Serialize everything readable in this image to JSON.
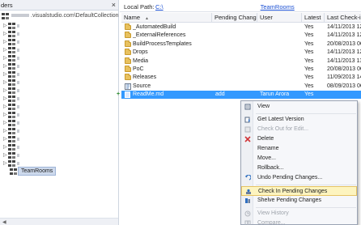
{
  "left_pane": {
    "title": "ders",
    "close_glyph": "×",
    "root_label": ".visualstudio.com\\DefaultCollection",
    "tree_item_count": 18,
    "selected_item": "TeamRooms"
  },
  "local_path": {
    "label": "Local Path:",
    "value_start": "C:\\",
    "value_end": "TeamRooms"
  },
  "grid": {
    "columns": [
      "Name",
      "Pending Change",
      "User",
      "Latest",
      "Last Check-in"
    ],
    "rows": [
      {
        "icon": "folder-icon",
        "name": "_AutomatedBuild",
        "pending": "",
        "user": "",
        "latest": "Yes",
        "date": "14/11/2013 12"
      },
      {
        "icon": "folder-icon",
        "name": "_ExternalReferences",
        "pending": "",
        "user": "",
        "latest": "Yes",
        "date": "14/11/2013 12"
      },
      {
        "icon": "folder-icon",
        "name": "BuildProcessTemplates",
        "pending": "",
        "user": "",
        "latest": "Yes",
        "date": "20/08/2013 06"
      },
      {
        "icon": "folder-icon",
        "name": "Drops",
        "pending": "",
        "user": "",
        "latest": "Yes",
        "date": "14/11/2013 12"
      },
      {
        "icon": "folder-icon",
        "name": "Media",
        "pending": "",
        "user": "",
        "latest": "Yes",
        "date": "14/11/2013 13"
      },
      {
        "icon": "folder-icon",
        "name": "PoC",
        "pending": "",
        "user": "",
        "latest": "Yes",
        "date": "20/08/2013 06"
      },
      {
        "icon": "folder-icon",
        "name": "Releases",
        "pending": "",
        "user": "",
        "latest": "Yes",
        "date": "11/09/2013 14"
      },
      {
        "icon": "source-icon",
        "name": "Source",
        "pending": "",
        "user": "",
        "latest": "Yes",
        "date": "08/09/2013 06"
      },
      {
        "icon": "file-icon",
        "name": "ReadMe.md",
        "pending": "add",
        "user": "Tarun Arora",
        "latest": "Yes",
        "date": ""
      }
    ],
    "selected_row": 8
  },
  "context_menu": {
    "items": [
      {
        "label": "View",
        "icon": "view-icon",
        "enabled": true
      },
      {
        "separator": true
      },
      {
        "label": "Get Latest Version",
        "icon": "get-latest-icon",
        "enabled": true
      },
      {
        "label": "Check Out for Edit...",
        "icon": "checkout-icon",
        "enabled": false
      },
      {
        "label": "Delete",
        "icon": "delete-x-icon",
        "enabled": true
      },
      {
        "label": "Rename",
        "icon": "",
        "enabled": true
      },
      {
        "label": "Move...",
        "icon": "",
        "enabled": true
      },
      {
        "label": "Rollback...",
        "icon": "",
        "enabled": true
      },
      {
        "label": "Undo Pending Changes...",
        "icon": "undo-icon",
        "enabled": true
      },
      {
        "separator": true
      },
      {
        "label": "Check In Pending Changes",
        "icon": "checkin-icon",
        "enabled": true,
        "hover": true
      },
      {
        "label": "Shelve Pending Changes",
        "icon": "shelve-icon",
        "enabled": true
      },
      {
        "separator": true
      },
      {
        "label": "View History",
        "icon": "history-icon",
        "enabled": false
      },
      {
        "label": "Compare...",
        "icon": "compare-icon",
        "enabled": false
      }
    ]
  },
  "colors": {
    "selection": "#3399ff",
    "menu_hover": "#fdf4bf",
    "link": "#1a4fd3",
    "delete_red": "#d13438"
  }
}
